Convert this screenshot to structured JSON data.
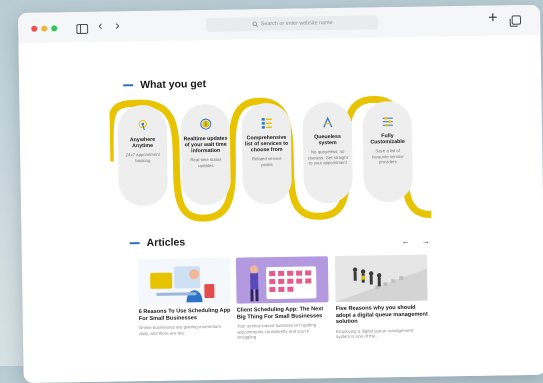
{
  "browser": {
    "url_placeholder": "Search or enter website name",
    "icons": [
      "sidebar-icon",
      "back-icon",
      "forward-icon",
      "search-icon",
      "plus-icon",
      "tabs-icon"
    ]
  },
  "what_you_get": {
    "title": "What you get",
    "accent_color": "#e8c300",
    "items": [
      {
        "title": "Anywhere Anytime",
        "desc": "24x7 appointment booking",
        "icon": "touch-icon"
      },
      {
        "title": "Realtime updates of your wait time information",
        "desc": "Real-time status updates",
        "icon": "info-icon"
      },
      {
        "title": "Comprehensive list of services to choose from",
        "desc": "Related service points",
        "icon": "list-icon"
      },
      {
        "title": "Queueless system",
        "desc": "No queueless, no clueless. Get straight to your appointment",
        "icon": "queue-icon"
      },
      {
        "title": "Fully Customizable",
        "desc": "Save a list of favourite service providers",
        "icon": "sliders-icon"
      }
    ]
  },
  "articles": {
    "title": "Articles",
    "prev": "←",
    "next": "→",
    "items": [
      {
        "title": "6 Reasons To Use Scheduling App For Small Businesses",
        "desc": "Online businesses are gaining momentum daily, and there are two"
      },
      {
        "title": "Client Scheduling App: The Next Big Thing For Small Businesses",
        "desc": "Your service-based business isn't getting appointments consistently and you're struggling"
      },
      {
        "title": "Five Reasons why you should adopt a digital queue management solution",
        "desc": "Employing a digital queue management system is one of the..."
      }
    ]
  }
}
